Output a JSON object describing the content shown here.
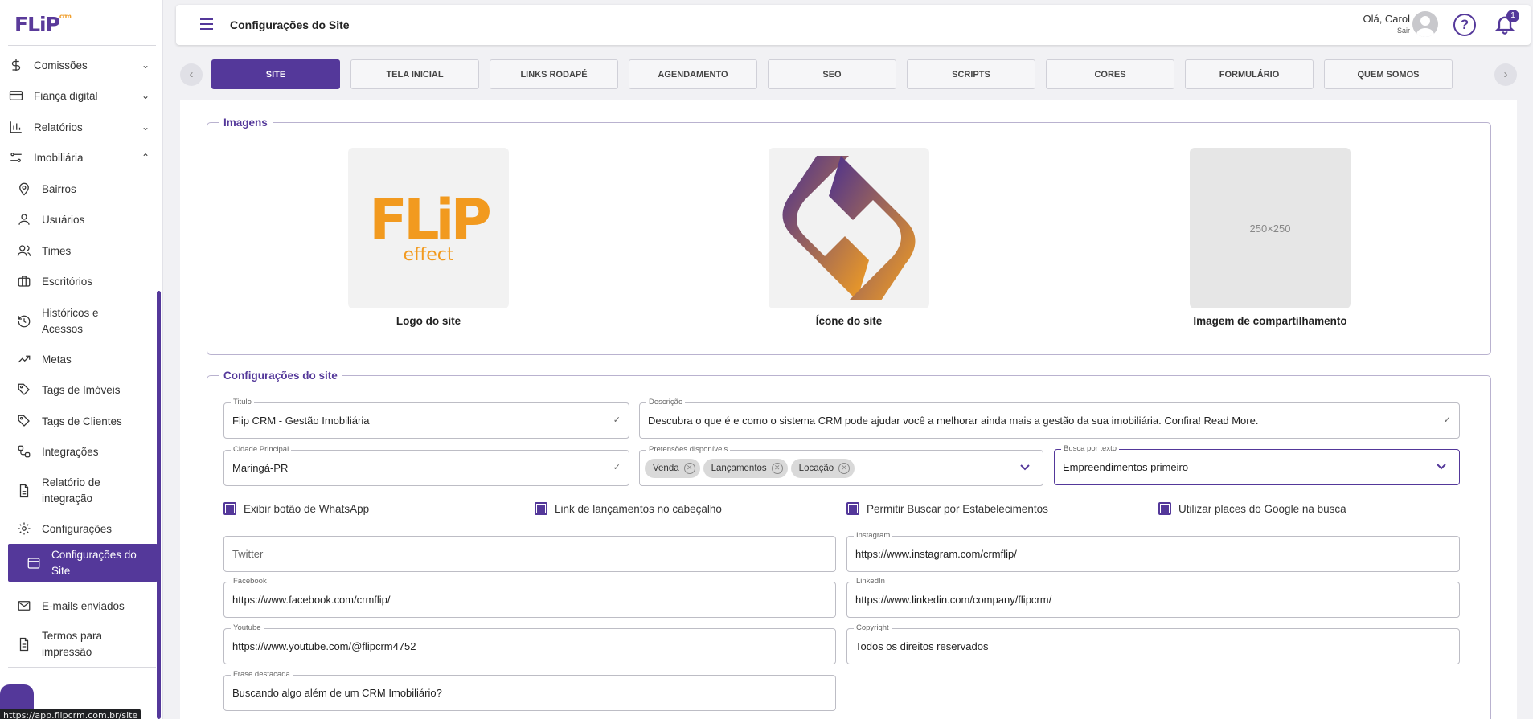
{
  "app": {
    "logo_text": "FLiP",
    "logo_suffix": "crm"
  },
  "sidebar": {
    "items": [
      {
        "label": "Comissões",
        "icon": "dollar-icon"
      },
      {
        "label": "Fiança digital",
        "icon": "credit-card-icon"
      },
      {
        "label": "Relatórios",
        "icon": "bar-chart-icon"
      },
      {
        "label": "Imobiliária",
        "icon": "sliders-icon"
      }
    ],
    "sub_items": [
      {
        "label": "Bairros",
        "icon": "map-pin-icon"
      },
      {
        "label": "Usuários",
        "icon": "user-icon"
      },
      {
        "label": "Times",
        "icon": "users-icon"
      },
      {
        "label": "Escritórios",
        "icon": "briefcase-icon"
      },
      {
        "label": "Históricos e Acessos",
        "icon": "history-icon"
      },
      {
        "label": "Metas",
        "icon": "trending-up-icon"
      },
      {
        "label": "Tags de Imóveis",
        "icon": "tag-icon"
      },
      {
        "label": "Tags de Clientes",
        "icon": "tag-icon"
      },
      {
        "label": "Integrações",
        "icon": "integration-icon"
      },
      {
        "label": "Relatório de integração",
        "icon": "file-icon"
      },
      {
        "label": "Configurações",
        "icon": "gear-icon"
      },
      {
        "label": "Configurações do Site",
        "icon": "browser-window-icon"
      },
      {
        "label": "E-mails enviados",
        "icon": "mail-icon"
      },
      {
        "label": "Termos para impressão",
        "icon": "document-icon"
      }
    ],
    "url_tooltip": "https://app.flipcrm.com.br/site"
  },
  "topbar": {
    "title": "Configurações do Site",
    "greeting": "Olá, Carol",
    "logout": "Sair",
    "notification_count": "1"
  },
  "tabs": [
    "SITE",
    "TELA INICIAL",
    "LINKS RODAPÉ",
    "AGENDAMENTO",
    "SEO",
    "SCRIPTS",
    "CORES",
    "FORMULÁRIO",
    "QUEM SOMOS",
    ""
  ],
  "images": {
    "legend": "Imagens",
    "logo_label": "Logo do site",
    "logo_text": "FLiP",
    "logo_sub": "effect",
    "icon_label": "Ícone do site",
    "share_label": "Imagem de compartilhamento",
    "share_placeholder": "250×250"
  },
  "config": {
    "legend": "Configurações do site",
    "titulo_label": "Titulo",
    "titulo_value": "Flip CRM - Gestão Imobiliária",
    "descricao_label": "Descrição",
    "descricao_value": "Descubra o que é e como o sistema CRM pode ajudar você a melhorar ainda mais a gestão da sua imobiliária. Confira! Read More.",
    "cidade_label": "Cidade Principal",
    "cidade_value": "Maringá-PR",
    "pretensoes_label": "Pretensões disponíveis",
    "pretensoes_chips": [
      "Venda",
      "Lançamentos",
      "Locação"
    ],
    "busca_label": "Busca por texto",
    "busca_value": "Empreendimentos primeiro",
    "checks": [
      "Exibir botão de WhatsApp",
      "Link de lançamentos no cabeçalho",
      "Permitir Buscar por Estabelecimentos",
      "Utilizar places do Google na busca"
    ],
    "twitter_placeholder": "Twitter",
    "instagram_label": "Instagram",
    "instagram_value": "https://www.instagram.com/crmflip/",
    "facebook_label": "Facebook",
    "facebook_value": "https://www.facebook.com/crmflip/",
    "linkedin_label": "LinkedIn",
    "linkedin_value": "https://www.linkedin.com/company/flipcrm/",
    "youtube_label": "Youtube",
    "youtube_value": "https://www.youtube.com/@flipcrm4752",
    "copyright_label": "Copyright",
    "copyright_value": "Todos os direitos reservados",
    "frase_label": "Frase destacada",
    "frase_value": "Buscando algo além de um CRM Imobiliário?"
  },
  "colors": {
    "accent": "#54389a",
    "brand_orange": "#f29a1f"
  }
}
